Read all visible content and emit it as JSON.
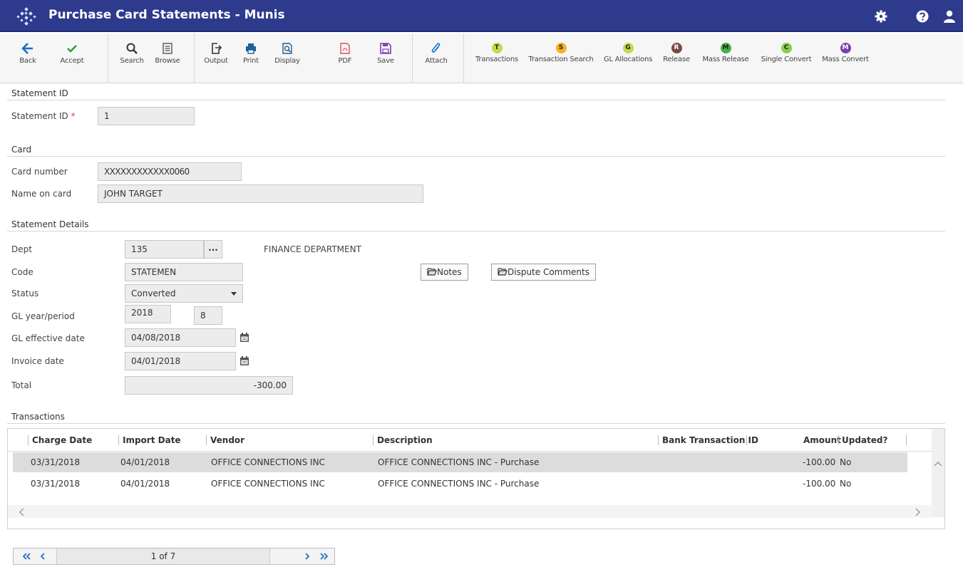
{
  "app": {
    "title": "Purchase Card Statements - Munis"
  },
  "toolbar": {
    "back": "Back",
    "accept": "Accept",
    "search": "Search",
    "browse": "Browse",
    "output": "Output",
    "print": "Print",
    "display": "Display",
    "pdf": "PDF",
    "save": "Save",
    "attach": "Attach",
    "transactions": "Transactions",
    "transaction_search": "Transaction Search",
    "gl_allocations": "GL Allocations",
    "release": "Release",
    "mass_release": "Mass Release",
    "single_convert": "Single Convert",
    "mass_convert": "Mass Convert",
    "badges": {
      "transactions": "T",
      "transaction_search": "S",
      "gl_allocations": "G",
      "release": "R",
      "mass_release": "M",
      "single_convert": "C",
      "mass_convert": "M"
    },
    "badge_colors": {
      "transactions": "#c9d84a",
      "transaction_search": "#f5b41c",
      "gl_allocations": "#c3da4a",
      "release": "#7a4a45",
      "mass_release": "#45b045",
      "single_convert": "#8ccf4d",
      "mass_convert": "#7a3fb0"
    }
  },
  "statement_id_section": {
    "title": "Statement ID",
    "label": "Statement ID",
    "required_mark": "*",
    "value": "1"
  },
  "card_section": {
    "title": "Card",
    "card_number_label": "Card number",
    "card_number_value": "XXXXXXXXXXXX0060",
    "name_label": "Name on card",
    "name_value": "JOHN TARGET"
  },
  "details_section": {
    "title": "Statement Details",
    "dept_label": "Dept",
    "dept_value": "135",
    "dept_lookup": "...",
    "dept_name": "FINANCE DEPARTMENT",
    "code_label": "Code",
    "code_value": "STATEMEN",
    "status_label": "Status",
    "status_value": "Converted",
    "gl_year_label": "GL year/period",
    "gl_year_value": "2018",
    "gl_period_value": "8",
    "gl_eff_label": "GL effective date",
    "gl_eff_value": "04/08/2018",
    "invoice_label": "Invoice date",
    "invoice_value": "04/01/2018",
    "total_label": "Total",
    "total_value": "-300.00",
    "notes_button": "Notes",
    "dispute_button": "Dispute Comments"
  },
  "transactions": {
    "title": "Transactions",
    "columns": [
      "Charge Date",
      "Import Date",
      "Vendor",
      "Description",
      "Bank Transaction ID",
      "Amount",
      "Updated?"
    ],
    "rows": [
      [
        "03/31/2018",
        "04/01/2018",
        "OFFICE CONNECTIONS INC",
        "OFFICE CONNECTIONS INC - Purchase",
        "",
        "-100.00",
        "No"
      ],
      [
        "03/31/2018",
        "04/01/2018",
        "OFFICE CONNECTIONS INC",
        "OFFICE CONNECTIONS INC - Purchase",
        "",
        "-100.00",
        "No"
      ]
    ]
  },
  "pager": {
    "text": "1 of 7"
  },
  "colors": {
    "titlebar": "#2e3a8c",
    "selected_row": "#dcdcdc",
    "required": "#e43d30"
  }
}
